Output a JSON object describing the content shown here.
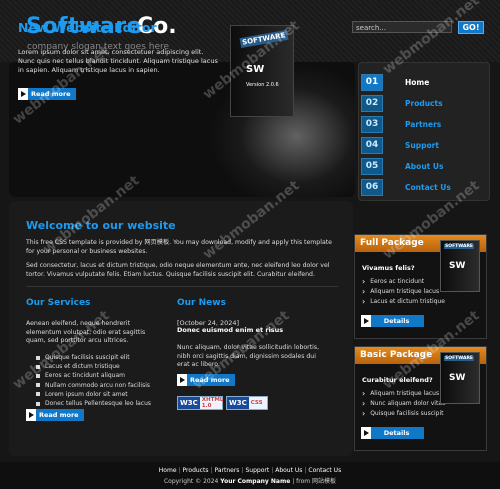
{
  "header": {
    "logo_word1": "Software",
    "logo_word2": "Co.",
    "slogan": "company slogan text goes here",
    "search_placeholder": "search...",
    "search_button": "GO!"
  },
  "banner": {
    "title": "New Website Editor",
    "text": "Lorem ipsum dolor sit amet, consectetuer adipiscing elit. Nunc quis nec tellus blandit tincidunt. Aliquam tristique lacus in sapien. Aliquam tristique lacus in sapien.",
    "read_more": "Read more",
    "box_label": "SOFTWARE",
    "box_sw": "SW",
    "box_version": "Version 2.0.6"
  },
  "nav": {
    "items": [
      {
        "num": "01",
        "label": "Home"
      },
      {
        "num": "02",
        "label": "Products"
      },
      {
        "num": "03",
        "label": "Partners"
      },
      {
        "num": "04",
        "label": "Support"
      },
      {
        "num": "05",
        "label": "About Us"
      },
      {
        "num": "06",
        "label": "Contact Us"
      }
    ]
  },
  "welcome": {
    "title": "Welcome to our website",
    "p1": "This free CSS template is provided by 网页模板. You may download, modify and apply this template for your personal or business websites.",
    "p2": "Sed consectetur, lacus et dictum tristique, odio neque elementum ante, nec eleifend leo dolor vel tortor. Vivamus vulputate felis. Etiam luctus. Quisque facilisis suscipit elit. Curabitur eleifend."
  },
  "services": {
    "title": "Our Services",
    "text": "Aenean eleifend, neque hendrerit elementum volutpat, odio erat sagittis quam, sed porttitor arcu ultrices.",
    "items": [
      "Quisque facilisis suscipit elit",
      "Lacus et dictum tristique",
      "Eeros ac tincidunt aliquam",
      "Nullam commodo arcu non facilisis",
      "Lorem ipsum dolor sit amet",
      "Donec tellus Pellentesque leo lacus"
    ],
    "read_more": "Read more"
  },
  "news": {
    "title": "Our News",
    "date": "[October 24, 2024]",
    "headline": "Donec euismod enim et risus",
    "text": "Nunc aliquam, dolor vitae sollicitudin lobortis, nibh orci sagittis diam, dignissim sodales dui erat ac libero.",
    "read_more": "Read more",
    "badge_w3c": "W3C",
    "badge_xhtml": "XHTML 1.0",
    "badge_css": "CSS"
  },
  "packages": [
    {
      "title": "Full Package",
      "subtitle": "Vivamus felis?",
      "items": [
        "Eeros ac tincidunt",
        "Aliquam tristique lacus",
        "Lacus et dictum tristique"
      ],
      "button": "Details",
      "box_label": "SOFTWARE",
      "box_sw": "SW"
    },
    {
      "title": "Basic Package",
      "subtitle": "Curabitur eleifend?",
      "items": [
        "Aliquam tristique lacus",
        "Nunc aliquam dolor vitae",
        "Quisque facilisis suscipit"
      ],
      "button": "Details",
      "box_label": "SOFTWARE",
      "box_sw": "SW"
    }
  ],
  "footer": {
    "links": [
      "Home",
      "Products",
      "Partners",
      "Support",
      "About Us",
      "Contact Us"
    ],
    "copyright_prefix": "Copyright © 2024",
    "company": "Your Company Name",
    "from_text": "| from 网站模板"
  },
  "watermark": "webmoban.net"
}
